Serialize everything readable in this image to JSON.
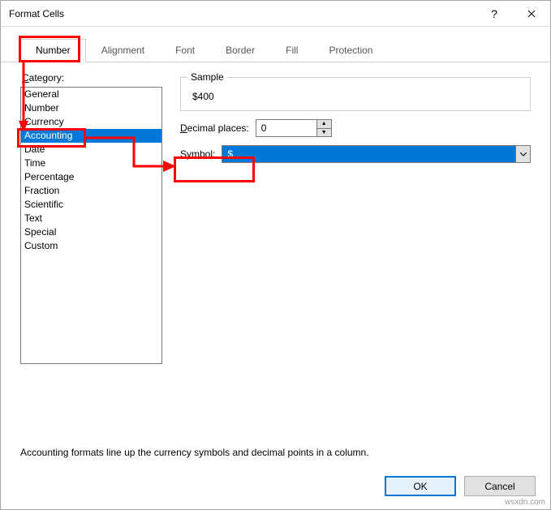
{
  "window": {
    "title": "Format Cells"
  },
  "tabs": {
    "number": "Number",
    "alignment": "Alignment",
    "font": "Font",
    "border": "Border",
    "fill": "Fill",
    "protection": "Protection"
  },
  "category": {
    "label_pre": "C",
    "label_post": "ategory:",
    "items": [
      "General",
      "Number",
      "Currency",
      "Accounting",
      "Date",
      "Time",
      "Percentage",
      "Fraction",
      "Scientific",
      "Text",
      "Special",
      "Custom"
    ],
    "selected_index": 3
  },
  "sample": {
    "legend": "Sample",
    "value": "$400"
  },
  "decimal": {
    "label_pre": "D",
    "label_post": "ecimal places:",
    "value": "0"
  },
  "symbol": {
    "label_pre": "S",
    "label_post": "ymbol:",
    "value": "$"
  },
  "description": "Accounting formats line up the currency symbols and decimal points in a column.",
  "footer": {
    "ok": "OK",
    "cancel": "Cancel"
  },
  "watermark": "wsxdn.com"
}
